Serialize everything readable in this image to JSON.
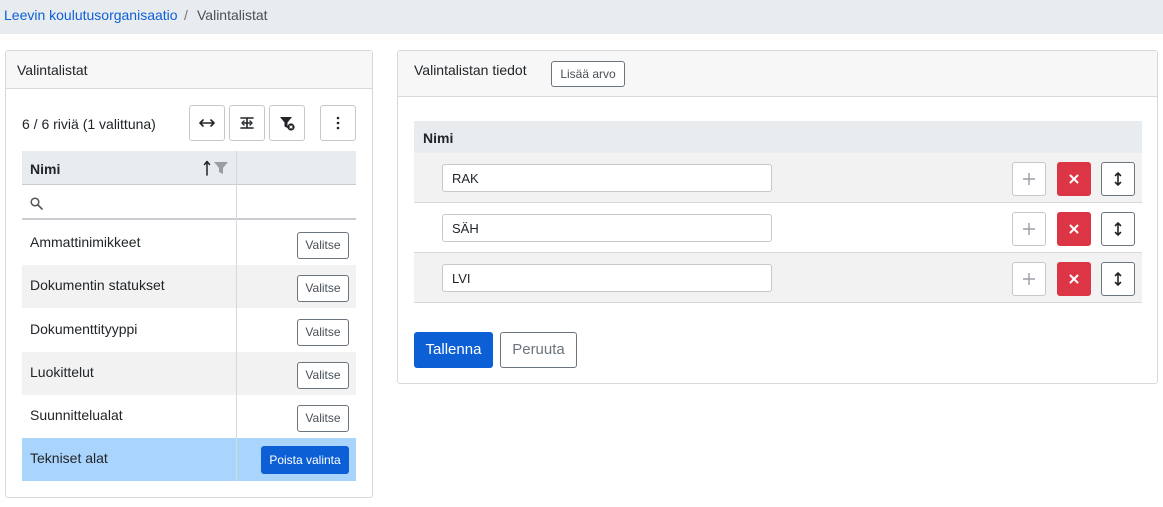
{
  "breadcrumb": {
    "organization": "Leevin koulutusorganisaatio",
    "separator": "/",
    "current": "Valintalistat"
  },
  "lists_panel": {
    "title": "Valintalistat",
    "row_count_text": "6 / 6 riviä (1 valittuna)",
    "toolbar_icons": [
      "fit-columns-icon",
      "group-columns-icon",
      "clear-filter-icon",
      "more-vertical-icon"
    ],
    "column_header": "Nimi",
    "sort_direction": "ascending",
    "filter_value": "",
    "select_label": "Valitse",
    "deselect_label": "Poista valinta",
    "rows": [
      {
        "name": "Ammattinimikkeet",
        "selected": false
      },
      {
        "name": "Dokumentin statukset",
        "selected": false
      },
      {
        "name": "Dokumenttityyppi",
        "selected": false
      },
      {
        "name": "Luokittelut",
        "selected": false
      },
      {
        "name": "Suunnittelualat",
        "selected": false
      },
      {
        "name": "Tekniset alat",
        "selected": true
      }
    ]
  },
  "details_panel": {
    "title": "Valintalistan tiedot",
    "add_value_label": "Lisää arvo",
    "column_header": "Nimi",
    "values": [
      "RAK",
      "SÄH",
      "LVI"
    ],
    "row_actions": [
      "plus-icon",
      "remove-icon",
      "move-vertical-icon"
    ],
    "save_label": "Tallenna",
    "cancel_label": "Peruuta"
  },
  "colors": {
    "primary": "#0d5fd6",
    "danger": "#dc3545",
    "selected_row": "#a9d4fb",
    "header_bg": "#e9ecef"
  }
}
